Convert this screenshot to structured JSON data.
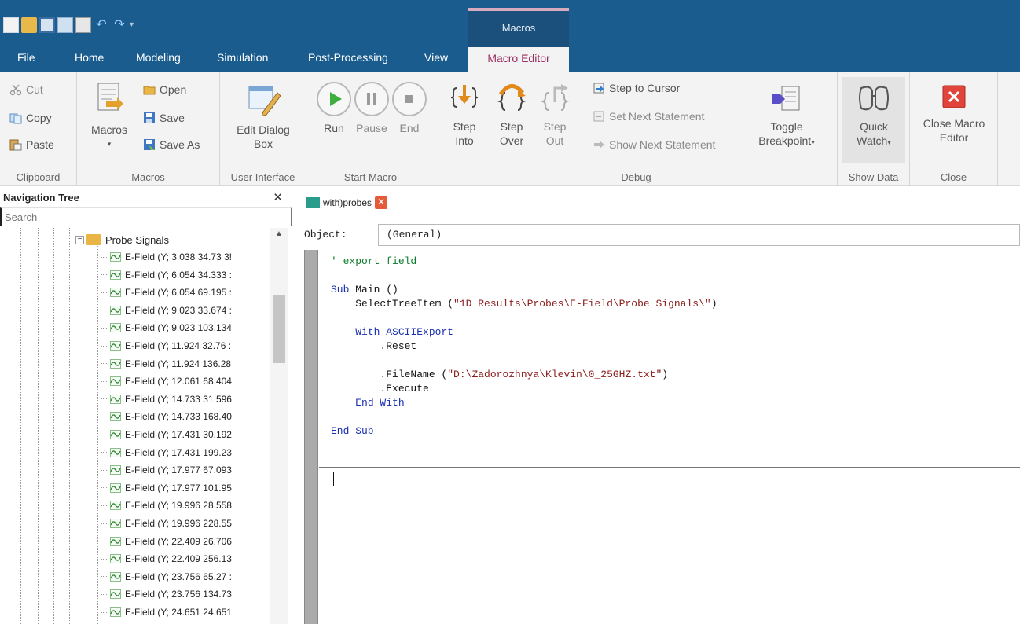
{
  "quick_access": [
    "new-icon",
    "open-icon",
    "save-icon",
    "copy-icon",
    "print-icon",
    "undo-icon",
    "redo-icon"
  ],
  "context_tab": {
    "label": "Macros"
  },
  "menu": {
    "file": "File",
    "home": "Home",
    "modeling": "Modeling",
    "simulation": "Simulation",
    "post_processing": "Post-Processing",
    "view": "View",
    "macro_editor": "Macro Editor"
  },
  "ribbon": {
    "clipboard": {
      "label": "Clipboard",
      "cut": "Cut",
      "copy": "Copy",
      "paste": "Paste"
    },
    "macros": {
      "label": "Macros",
      "macros_btn": "Macros",
      "open": "Open",
      "save": "Save",
      "save_as": "Save As"
    },
    "user_interface": {
      "label": "User Interface",
      "edit_dialog_1": "Edit Dialog",
      "edit_dialog_2": "Box"
    },
    "start_macro": {
      "label": "Start Macro",
      "run": "Run",
      "pause": "Pause",
      "end": "End"
    },
    "debug": {
      "label": "Debug",
      "step_into_1": "Step",
      "step_into_2": "Into",
      "step_over_1": "Step",
      "step_over_2": "Over",
      "step_out_1": "Step",
      "step_out_2": "Out",
      "step_to_cursor": "Step to Cursor",
      "set_next_statement": "Set Next Statement",
      "show_next_statement": "Show Next Statement",
      "toggle_1": "Toggle",
      "toggle_2": "Breakpoint"
    },
    "show_data": {
      "label": "Show Data",
      "quick_1": "Quick",
      "quick_2": "Watch"
    },
    "close": {
      "label": "Close",
      "close_1": "Close Macro",
      "close_2": "Editor"
    }
  },
  "nav": {
    "title": "Navigation Tree",
    "search_placeholder": "Search",
    "parent": "Probe Signals",
    "items": [
      "E-Field (Y; 3.038 34.73 3!",
      "E-Field (Y; 6.054 34.333 :",
      "E-Field (Y; 6.054 69.195 :",
      "E-Field (Y; 9.023 33.674 :",
      "E-Field (Y; 9.023 103.134",
      "E-Field (Y; 11.924 32.76 :",
      "E-Field (Y; 11.924 136.28",
      "E-Field (Y; 12.061 68.404",
      "E-Field (Y; 14.733 31.596",
      "E-Field (Y; 14.733 168.40",
      "E-Field (Y; 17.431 30.192",
      "E-Field (Y; 17.431 199.23",
      "E-Field (Y; 17.977 67.093",
      "E-Field (Y; 17.977 101.95",
      "E-Field (Y; 19.996 28.558",
      "E-Field (Y; 19.996 228.55",
      "E-Field (Y; 22.409 26.706",
      "E-Field (Y; 22.409 256.13",
      "E-Field (Y; 23.756 65.27 :",
      "E-Field (Y; 23.756 134.73",
      "E-Field (Y; 24.651 24.651"
    ]
  },
  "editor": {
    "tab_label": "with)probes",
    "object_label": "Object:",
    "object_value": "(General)",
    "code": [
      [
        {
          "t": "' export field",
          "c": "cm"
        }
      ],
      [
        {
          "t": "",
          "c": ""
        }
      ],
      [
        {
          "t": "Sub",
          "c": "kw"
        },
        {
          "t": " Main ()",
          "c": ""
        }
      ],
      [
        {
          "t": "    SelectTreeItem (",
          "c": ""
        },
        {
          "t": "\"1D Results\\Probes\\E-Field\\Probe Signals\\\"",
          "c": "st"
        },
        {
          "t": ")",
          "c": ""
        }
      ],
      [
        {
          "t": "",
          "c": ""
        }
      ],
      [
        {
          "t": "    ",
          "c": ""
        },
        {
          "t": "With",
          "c": "kw"
        },
        {
          "t": " ASCIIExport",
          "c": "kw"
        }
      ],
      [
        {
          "t": "        .Reset",
          "c": ""
        }
      ],
      [
        {
          "t": "",
          "c": ""
        }
      ],
      [
        {
          "t": "        .FileName (",
          "c": ""
        },
        {
          "t": "\"D:\\Zadorozhnya\\Klevin\\0_25GHZ.txt\"",
          "c": "st"
        },
        {
          "t": ")",
          "c": ""
        }
      ],
      [
        {
          "t": "        .Execute",
          "c": ""
        }
      ],
      [
        {
          "t": "    ",
          "c": ""
        },
        {
          "t": "End With",
          "c": "kw"
        }
      ],
      [
        {
          "t": "",
          "c": ""
        }
      ],
      [
        {
          "t": "End Sub",
          "c": "kw"
        }
      ]
    ]
  }
}
